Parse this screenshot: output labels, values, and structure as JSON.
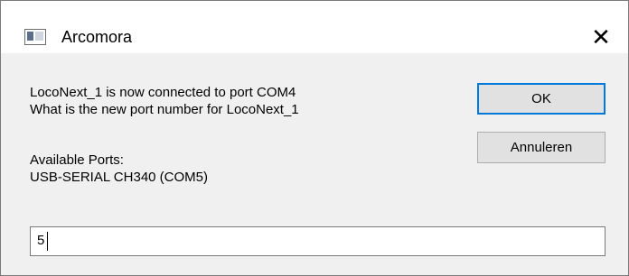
{
  "window": {
    "title": "Arcomora",
    "app_icon": "app-window-icon",
    "close_glyph": "✕"
  },
  "message": {
    "line1": "LocoNext_1 is now connected to port COM4",
    "line2": "What is the new port number for LocoNext_1",
    "ports_heading": "Available Ports:",
    "ports_list": "USB-SERIAL CH340 (COM5)"
  },
  "buttons": {
    "ok_label": "OK",
    "cancel_label": "Annuleren"
  },
  "input": {
    "value": "5"
  }
}
